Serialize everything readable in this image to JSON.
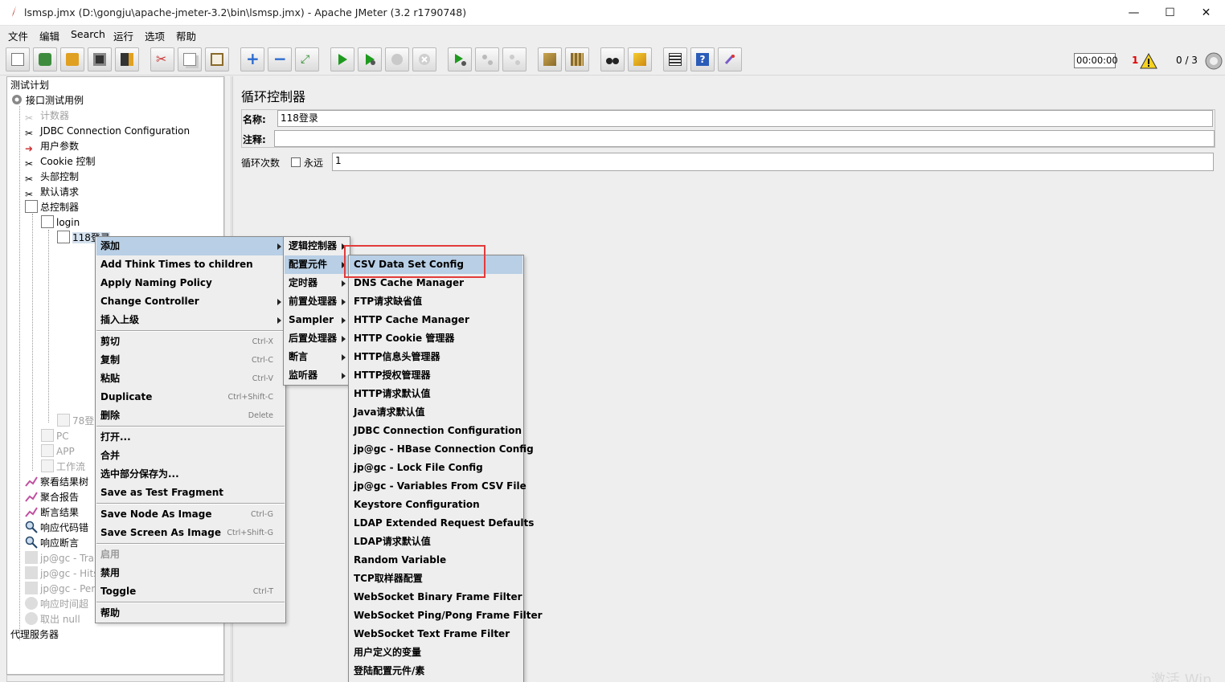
{
  "window": {
    "title": "lsmsp.jmx (D:\\gongju\\apache-jmeter-3.2\\bin\\lsmsp.jmx) - Apache JMeter (3.2 r1790748)",
    "minimize": "—",
    "maximize": "☐",
    "close": "✕"
  },
  "menubar": [
    "文件",
    "编辑",
    "Search",
    "运行",
    "选项",
    "帮助"
  ],
  "toolbar": {
    "timer": "00:00:00",
    "error_count": "1",
    "threads": "0 / 3"
  },
  "tree": {
    "root": "测试计划",
    "nodes": [
      {
        "label": "接口测试用例",
        "icon": "gear-icon"
      },
      {
        "label": "计数器",
        "icon": "scissors-icon",
        "disabled": true
      },
      {
        "label": "JDBC Connection Configuration",
        "icon": "scissors-icon"
      },
      {
        "label": "用户参数",
        "icon": "arrow-icon"
      },
      {
        "label": "Cookie 控制",
        "icon": "scissors-icon"
      },
      {
        "label": "头部控制",
        "icon": "scissors-icon"
      },
      {
        "label": "默认请求",
        "icon": "scissors-icon"
      },
      {
        "label": "总控制器",
        "icon": "controller-icon"
      },
      {
        "label": "login",
        "icon": "controller-icon"
      },
      {
        "label": "118登录",
        "icon": "controller-icon"
      },
      {
        "label": "78登",
        "icon": "controller-icon",
        "disabled": true
      },
      {
        "label": "PC",
        "icon": "controller-icon",
        "disabled": true
      },
      {
        "label": "APP",
        "icon": "controller-icon",
        "disabled": true
      },
      {
        "label": "工作流",
        "icon": "controller-icon",
        "disabled": true
      },
      {
        "label": "察看结果树",
        "icon": "chart-icon"
      },
      {
        "label": "聚合报告",
        "icon": "chart-icon"
      },
      {
        "label": "断言结果",
        "icon": "chart-icon"
      },
      {
        "label": "响应代码错",
        "icon": "magnifier-icon"
      },
      {
        "label": "响应断言",
        "icon": "magnifier-icon"
      },
      {
        "label": "jp@gc - Tra",
        "icon": "chart-icon",
        "disabled": true
      },
      {
        "label": "jp@gc - Hits",
        "icon": "chart-icon",
        "disabled": true
      },
      {
        "label": "jp@gc - Per",
        "icon": "chart-icon",
        "disabled": true
      },
      {
        "label": "响应时间超",
        "icon": "assertion-icon",
        "disabled": true
      },
      {
        "label": "取出 null",
        "icon": "assertion-icon",
        "disabled": true
      }
    ],
    "proxy": "代理服务器"
  },
  "panel": {
    "title": "循环控制器",
    "name_label": "名称:",
    "name_value": "118登录",
    "comment_label": "注释:",
    "comment_value": "",
    "loop_label": "循环次数",
    "forever_label": "永远",
    "loop_value": "1"
  },
  "context_menu": [
    {
      "label": "添加",
      "submenu": true,
      "selected": true
    },
    {
      "label": "Add Think Times to children"
    },
    {
      "label": "Apply Naming Policy"
    },
    {
      "label": "Change Controller",
      "submenu": true
    },
    {
      "label": "插入上级",
      "submenu": true
    },
    {
      "label": "剪切",
      "shortcut": "Ctrl-X"
    },
    {
      "label": "复制",
      "shortcut": "Ctrl-C"
    },
    {
      "label": "粘贴",
      "shortcut": "Ctrl-V"
    },
    {
      "label": "Duplicate",
      "shortcut": "Ctrl+Shift-C"
    },
    {
      "label": "删除",
      "shortcut": "Delete"
    },
    {
      "label": "打开..."
    },
    {
      "label": "合并"
    },
    {
      "label": "选中部分保存为..."
    },
    {
      "label": "Save as Test Fragment"
    },
    {
      "label": "Save Node As Image",
      "shortcut": "Ctrl-G"
    },
    {
      "label": "Save Screen As Image",
      "shortcut": "Ctrl+Shift-G"
    },
    {
      "label": "启用",
      "disabled": true
    },
    {
      "label": "禁用"
    },
    {
      "label": "Toggle",
      "shortcut": "Ctrl-T"
    },
    {
      "label": "帮助"
    }
  ],
  "add_submenu": [
    {
      "label": "逻辑控制器",
      "submenu": true
    },
    {
      "label": "配置元件",
      "submenu": true,
      "selected": true
    },
    {
      "label": "定时器",
      "submenu": true
    },
    {
      "label": "前置处理器",
      "submenu": true
    },
    {
      "label": "Sampler",
      "submenu": true
    },
    {
      "label": "后置处理器",
      "submenu": true
    },
    {
      "label": "断言",
      "submenu": true
    },
    {
      "label": "监听器",
      "submenu": true
    }
  ],
  "config_submenu": [
    {
      "label": "CSV Data Set Config",
      "selected": true
    },
    {
      "label": "DNS Cache Manager"
    },
    {
      "label": "FTP请求缺省值"
    },
    {
      "label": "HTTP Cache Manager"
    },
    {
      "label": "HTTP Cookie 管理器"
    },
    {
      "label": "HTTP信息头管理器"
    },
    {
      "label": "HTTP授权管理器"
    },
    {
      "label": "HTTP请求默认值"
    },
    {
      "label": "Java请求默认值"
    },
    {
      "label": "JDBC Connection Configuration"
    },
    {
      "label": "jp@gc - HBase Connection Config"
    },
    {
      "label": "jp@gc - Lock File Config"
    },
    {
      "label": "jp@gc - Variables From CSV File"
    },
    {
      "label": "Keystore Configuration"
    },
    {
      "label": "LDAP Extended Request Defaults"
    },
    {
      "label": "LDAP请求默认值"
    },
    {
      "label": "Random Variable"
    },
    {
      "label": "TCP取样器配置"
    },
    {
      "label": "WebSocket Binary Frame Filter"
    },
    {
      "label": "WebSocket Ping/Pong Frame Filter"
    },
    {
      "label": "WebSocket Text Frame Filter"
    },
    {
      "label": "用户定义的变量"
    },
    {
      "label": "登陆配置元件/素"
    }
  ],
  "watermark": "激活 Win"
}
